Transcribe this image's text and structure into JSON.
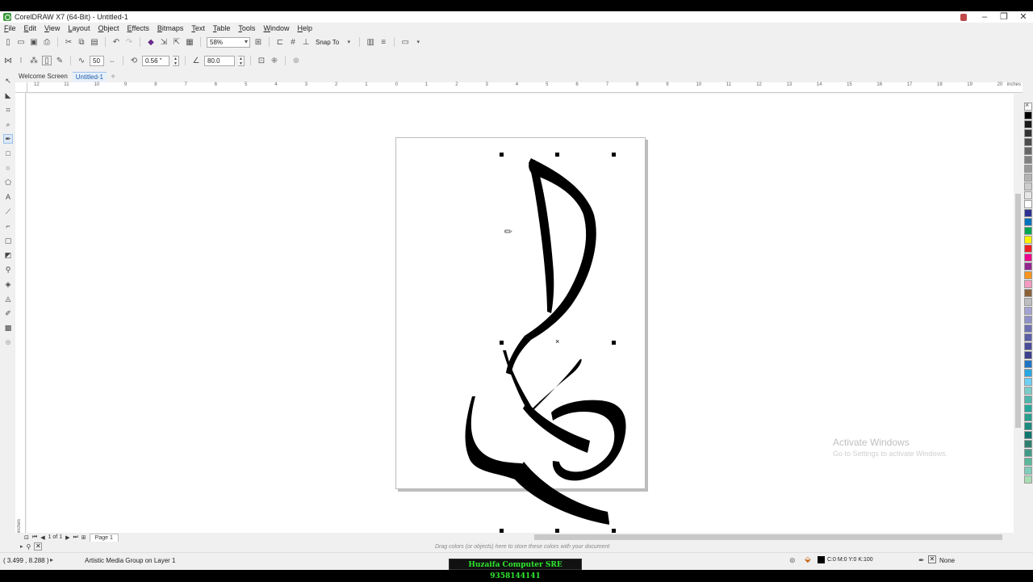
{
  "window": {
    "title": "CorelDRAW X7 (64-Bit) - Untitled-1"
  },
  "menu": [
    "File",
    "Edit",
    "View",
    "Layout",
    "Object",
    "Effects",
    "Bitmaps",
    "Text",
    "Table",
    "Tools",
    "Window",
    "Help"
  ],
  "toolbar": {
    "zoom": "58%",
    "snap_to": "Snap To"
  },
  "propbar": {
    "width_value": "50",
    "size_value": "0.56 \"",
    "angle_value": "80.0"
  },
  "tabs": [
    "Welcome Screen",
    "Untitled-1"
  ],
  "ruler": {
    "h_labels": [
      "12",
      "11",
      "10",
      "9",
      "8",
      "7",
      "6",
      "5",
      "4",
      "3",
      "2",
      "1",
      "0",
      "1",
      "2",
      "3",
      "4",
      "5",
      "6",
      "7",
      "8",
      "9",
      "10",
      "11",
      "12",
      "13",
      "14",
      "15",
      "16",
      "17",
      "18",
      "19",
      "20"
    ],
    "units": "inches"
  },
  "page_nav": {
    "counter": "1 of 1",
    "page_tab": "Page 1"
  },
  "doc_palette": {
    "hint": "Drag colors (or objects) here to store these colors with your document"
  },
  "watermark": {
    "title": "Activate Windows",
    "subtitle": "Go to Settings to activate Windows."
  },
  "status": {
    "coords": "( 3.499 , 8.288 )",
    "message": "Artistic Media Group on Layer 1",
    "fill": "C:0 M:0 Y:0 K:100",
    "outline": "None",
    "fill_color": "#000000"
  },
  "overlay_banner": "Huzaifa Computer SRE 9358144141",
  "palette": [
    "#000000",
    "#1a1a1a",
    "#333333",
    "#4d4d4d",
    "#666666",
    "#808080",
    "#999999",
    "#b3b3b3",
    "#cccccc",
    "#e6e6e6",
    "#ffffff",
    "#2e3192",
    "#0071bc",
    "#00a651",
    "#fff200",
    "#ed1c24",
    "#ec008c",
    "#92278f",
    "#f7941d",
    "#f49ac1",
    "#8c6239",
    "#bcbec0",
    "#a3a3d2",
    "#8f91c7",
    "#6d6fb3",
    "#5b5ea6",
    "#4a4d99",
    "#3c3f8c",
    "#1f74c4",
    "#29a7e1",
    "#6dcff6",
    "#7accc8",
    "#4db6ac",
    "#26a69a",
    "#2a9d8f",
    "#1b8a7f",
    "#0f766e",
    "#2f7f6f",
    "#3f9a85",
    "#5ab89b",
    "#7fcdbb",
    "#a8ddb5"
  ]
}
